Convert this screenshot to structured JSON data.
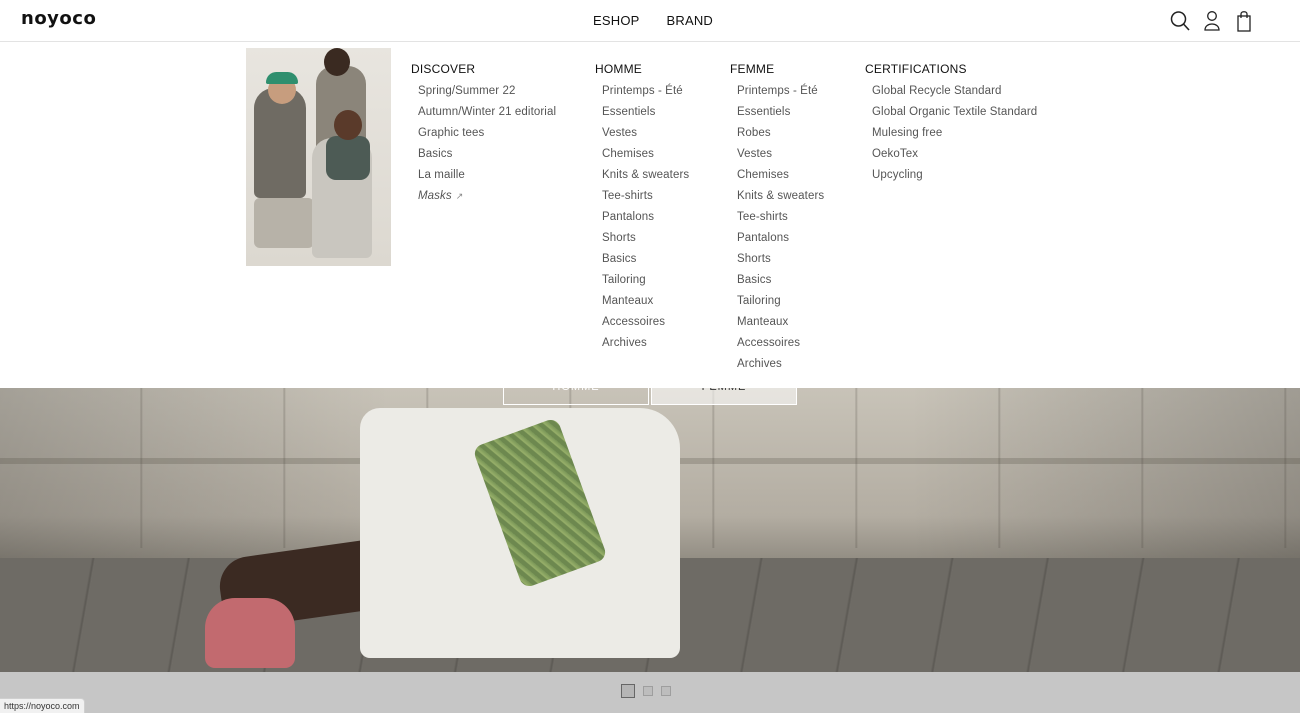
{
  "brand": {
    "logo": "noyoco"
  },
  "topnav": {
    "items": [
      "ESHOP",
      "BRAND"
    ]
  },
  "header_icons": [
    "search-icon",
    "account-icon",
    "bag-icon"
  ],
  "mega_menu": {
    "columns": [
      {
        "title": "DISCOVER",
        "items": [
          "Spring/Summer 22",
          "Autumn/Winter 21 editorial",
          "Graphic tees",
          "Basics",
          "La maille",
          "Masks"
        ]
      },
      {
        "title": "HOMME",
        "items": [
          "Printemps - Été",
          "Essentiels",
          "Vestes",
          "Chemises",
          "Knits & sweaters",
          "Tee-shirts",
          "Pantalons",
          "Shorts",
          "Basics",
          "Tailoring",
          "Manteaux",
          "Accessoires",
          "Archives"
        ]
      },
      {
        "title": "FEMME",
        "items": [
          "Printemps - Été",
          "Essentiels",
          "Robes",
          "Vestes",
          "Chemises",
          "Knits & sweaters",
          "Tee-shirts",
          "Pantalons",
          "Shorts",
          "Basics",
          "Tailoring",
          "Manteaux",
          "Accessoires",
          "Archives"
        ]
      },
      {
        "title": "CERTIFICATIONS",
        "items": [
          "Global Recycle Standard",
          "Global Organic Textile Standard",
          "Mulesing free",
          "OekoTex",
          "Upcycling"
        ]
      }
    ]
  },
  "hero": {
    "buttons": [
      "HOMME",
      "FEMME"
    ]
  },
  "slider": {
    "count": 3,
    "active": 1
  },
  "status_bar": {
    "url": "https://noyoco.com"
  }
}
